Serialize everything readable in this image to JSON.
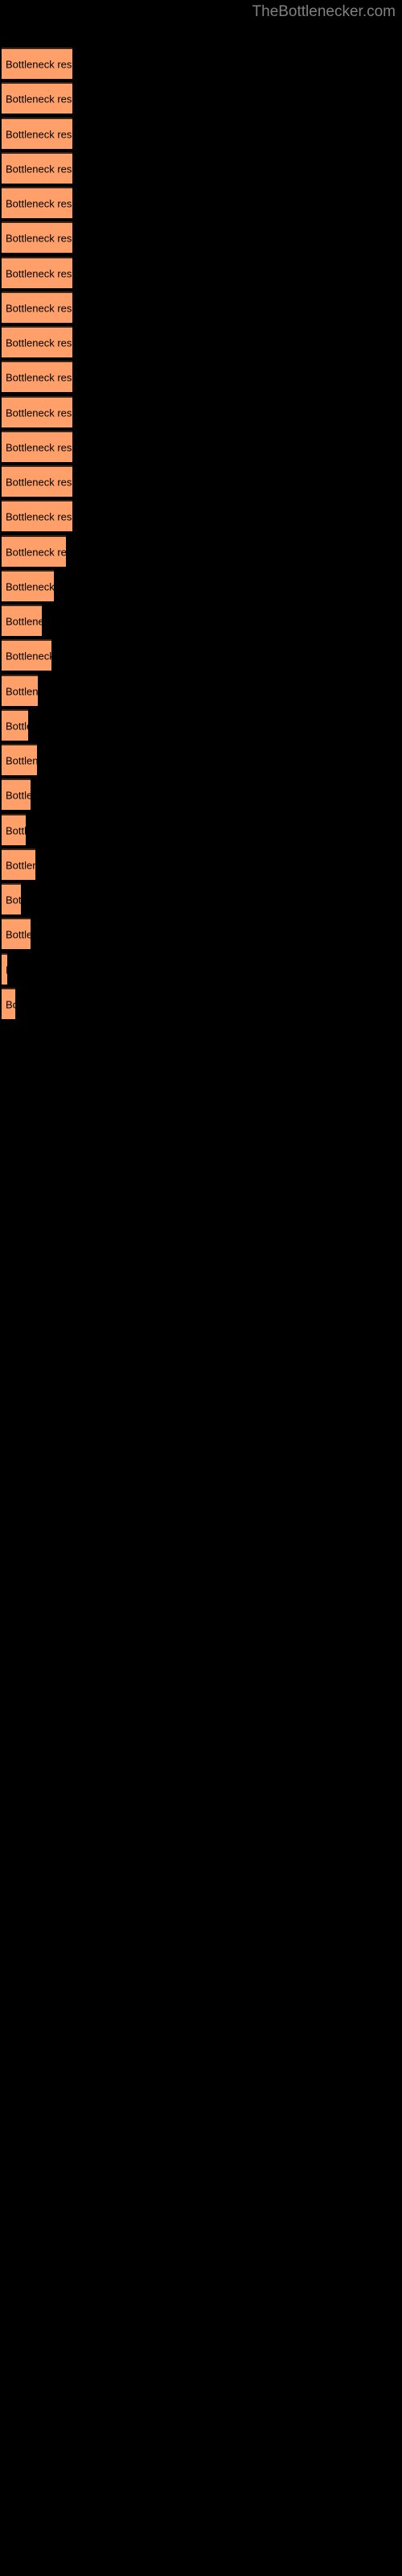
{
  "site": {
    "title": "TheBottlenecker.com",
    "title_color": "#808080",
    "background_color": "#000000"
  },
  "chart_data": {
    "type": "bar",
    "orientation": "horizontal",
    "title": "TheBottlenecker.com",
    "xlabel": "",
    "ylabel": "",
    "grid": false,
    "legend": null,
    "bar_color": "#ffa06a",
    "bar_border_color": "#3d2415",
    "label_color": "#000000",
    "bar_label_text": "Bottleneck result",
    "categories": [
      "Bottleneck result",
      "Bottleneck result",
      "Bottleneck result",
      "Bottleneck result",
      "Bottleneck result",
      "Bottleneck result",
      "Bottleneck result",
      "Bottleneck result",
      "Bottleneck result",
      "Bottleneck result",
      "Bottleneck result",
      "Bottleneck result",
      "Bottleneck result",
      "Bottleneck result",
      "Bottleneck result",
      "Bottleneck result",
      "Bottleneck result",
      "Bottleneck result",
      "Bottleneck result",
      "Bottleneck result",
      "Bottleneck result",
      "Bottleneck result",
      "Bottleneck result",
      "Bottleneck result",
      "Bottleneck result",
      "Bottleneck result",
      "Bottleneck result",
      "Bottleneck result"
    ],
    "values": [
      88,
      88,
      88,
      88,
      88,
      88,
      88,
      88,
      88,
      88,
      88,
      88,
      88,
      88,
      80,
      65,
      50,
      62,
      45,
      33,
      44,
      36,
      30,
      42,
      24,
      36,
      7,
      17
    ],
    "xlim": [
      0,
      88
    ],
    "bars": [
      {
        "index": 1,
        "label": "Bottleneck result",
        "width": 88,
        "top": 59
      },
      {
        "index": 2,
        "label": "Bottleneck result",
        "width": 88,
        "top": 102
      },
      {
        "index": 3,
        "label": "Bottleneck result",
        "width": 88,
        "top": 146
      },
      {
        "index": 4,
        "label": "Bottleneck result",
        "width": 88,
        "top": 189
      },
      {
        "index": 5,
        "label": "Bottleneck result",
        "width": 88,
        "top": 232
      },
      {
        "index": 6,
        "label": "Bottleneck result",
        "width": 88,
        "top": 275
      },
      {
        "index": 7,
        "label": "Bottleneck result",
        "width": 88,
        "top": 319
      },
      {
        "index": 8,
        "label": "Bottleneck result",
        "width": 88,
        "top": 362
      },
      {
        "index": 9,
        "label": "Bottleneck result",
        "width": 88,
        "top": 405
      },
      {
        "index": 10,
        "label": "Bottleneck result",
        "width": 88,
        "top": 448
      },
      {
        "index": 11,
        "label": "Bottleneck result",
        "width": 88,
        "top": 492
      },
      {
        "index": 12,
        "label": "Bottleneck result",
        "width": 88,
        "top": 535
      },
      {
        "index": 13,
        "label": "Bottleneck result",
        "width": 88,
        "top": 578
      },
      {
        "index": 14,
        "label": "Bottleneck result",
        "width": 88,
        "top": 621
      },
      {
        "index": 15,
        "label": "Bottleneck result",
        "width": 80,
        "top": 665
      },
      {
        "index": 16,
        "label": "Bottleneck result",
        "width": 65,
        "top": 708
      },
      {
        "index": 17,
        "label": "Bottleneck result",
        "width": 50,
        "top": 751
      },
      {
        "index": 18,
        "label": "Bottleneck result",
        "width": 62,
        "top": 794
      },
      {
        "index": 19,
        "label": "Bottleneck result",
        "width": 45,
        "top": 838
      },
      {
        "index": 20,
        "label": "Bottleneck result",
        "width": 33,
        "top": 881
      },
      {
        "index": 21,
        "label": "Bottleneck result",
        "width": 44,
        "top": 924
      },
      {
        "index": 22,
        "label": "Bottleneck result",
        "width": 36,
        "top": 967
      },
      {
        "index": 23,
        "label": "Bottleneck result",
        "width": 30,
        "top": 1011
      },
      {
        "index": 24,
        "label": "Bottleneck result",
        "width": 42,
        "top": 1054
      },
      {
        "index": 25,
        "label": "Bottleneck result",
        "width": 24,
        "top": 1097
      },
      {
        "index": 26,
        "label": "Bottleneck result",
        "width": 36,
        "top": 1140
      },
      {
        "index": 27,
        "label": "Bottleneck result",
        "width": 7,
        "top": 1184
      },
      {
        "index": 28,
        "label": "Bottleneck result",
        "width": 17,
        "top": 1227
      }
    ]
  }
}
